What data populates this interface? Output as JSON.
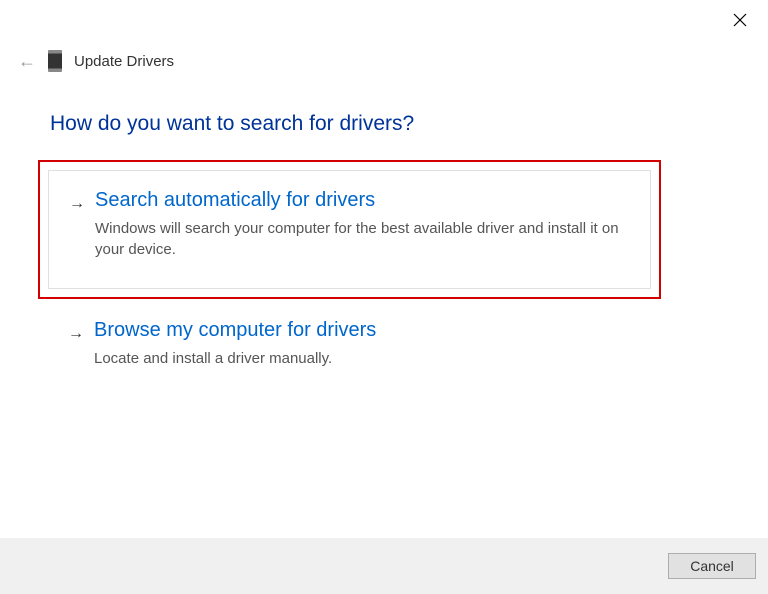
{
  "window": {
    "title": "Update Drivers"
  },
  "heading": "How do you want to search for drivers?",
  "options": {
    "auto": {
      "title": "Search automatically for drivers",
      "description": "Windows will search your computer for the best available driver and install it on your device."
    },
    "browse": {
      "title": "Browse my computer for drivers",
      "description": "Locate and install a driver manually."
    }
  },
  "footer": {
    "cancel_label": "Cancel"
  }
}
